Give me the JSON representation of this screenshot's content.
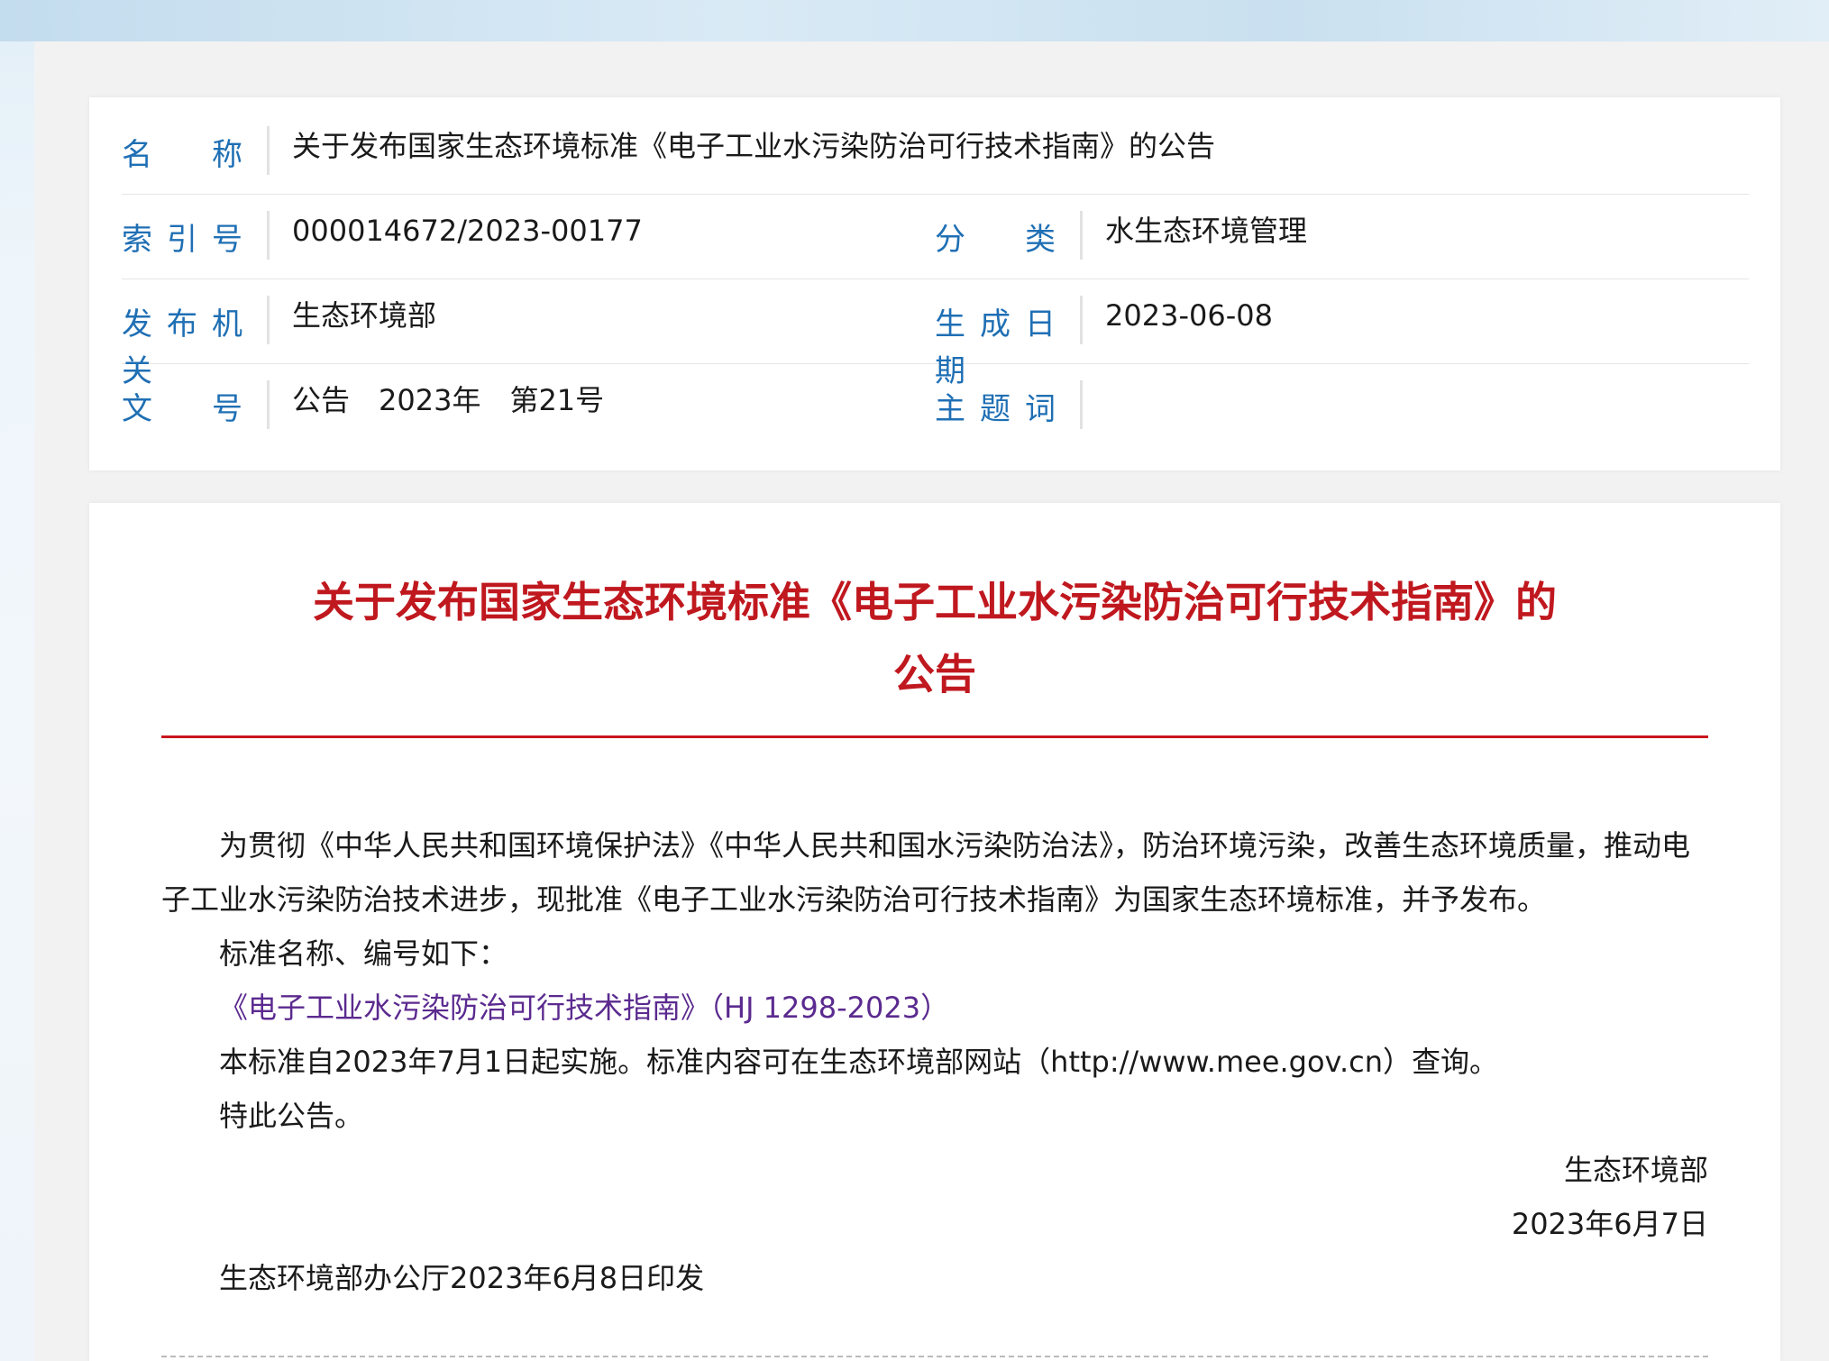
{
  "meta": {
    "name_label": "名称",
    "name_value": "关于发布国家生态环境标准《电子工业水污染防治可行技术指南》的公告",
    "index_label": "索引号",
    "index_value": "000014672/2023-00177",
    "category_label": "分类",
    "category_value": "水生态环境管理",
    "issuer_label": "发布机关",
    "issuer_value": "生态环境部",
    "date_label": "生成日期",
    "date_value": "2023-06-08",
    "docno_label": "文号",
    "docno_value": "公告　2023年　第21号",
    "keywords_label": "主题词",
    "keywords_value": ""
  },
  "article": {
    "title_line1": "关于发布国家生态环境标准《电子工业水污染防治可行技术指南》的",
    "title_line2": "公告",
    "para1": "为贯彻《中华人民共和国环境保护法》《中华人民共和国水污染防治法》，防治环境污染，改善生态环境质量，推动电子工业水污染防治技术进步，现批准《电子工业水污染防治可行技术指南》为国家生态环境标准，并予发布。",
    "para2": "标准名称、编号如下：",
    "standard_link": "《电子工业水污染防治可行技术指南》（HJ 1298-2023）",
    "para3": "本标准自2023年7月1日起实施。标准内容可在生态环境部网站（http://www.mee.gov.cn）查询。",
    "para4": "特此公告。",
    "signer": "生态环境部",
    "sign_date": "2023年6月7日",
    "issued_note": "生态环境部办公厅2023年6月8日印发"
  }
}
